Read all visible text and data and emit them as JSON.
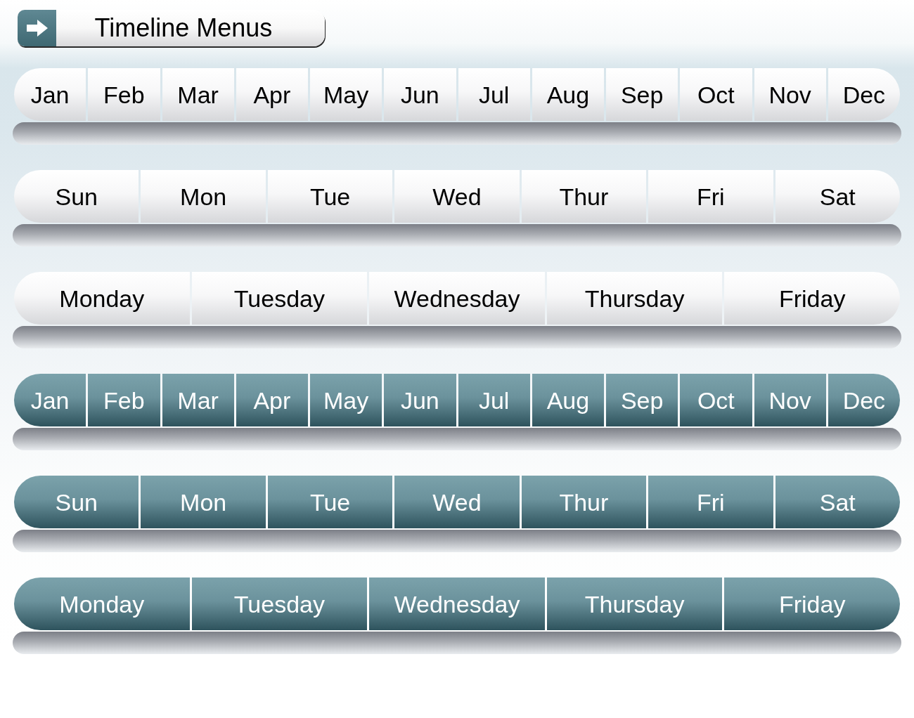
{
  "title_button": {
    "label": "Timeline Menus"
  },
  "menus": [
    {
      "kind": "light",
      "items": [
        "Jan",
        "Feb",
        "Mar",
        "Apr",
        "May",
        "Jun",
        "Jul",
        "Aug",
        "Sep",
        "Oct",
        "Nov",
        "Dec"
      ]
    },
    {
      "kind": "light",
      "items": [
        "Sun",
        "Mon",
        "Tue",
        "Wed",
        "Thur",
        "Fri",
        "Sat"
      ]
    },
    {
      "kind": "light",
      "items": [
        "Monday",
        "Tuesday",
        "Wednesday",
        "Thursday",
        "Friday"
      ]
    },
    {
      "kind": "teal",
      "items": [
        "Jan",
        "Feb",
        "Mar",
        "Apr",
        "May",
        "Jun",
        "Jul",
        "Aug",
        "Sep",
        "Oct",
        "Nov",
        "Dec"
      ]
    },
    {
      "kind": "teal",
      "items": [
        "Sun",
        "Mon",
        "Tue",
        "Wed",
        "Thur",
        "Fri",
        "Sat"
      ]
    },
    {
      "kind": "teal",
      "items": [
        "Monday",
        "Tuesday",
        "Wednesday",
        "Thursday",
        "Friday"
      ]
    }
  ]
}
